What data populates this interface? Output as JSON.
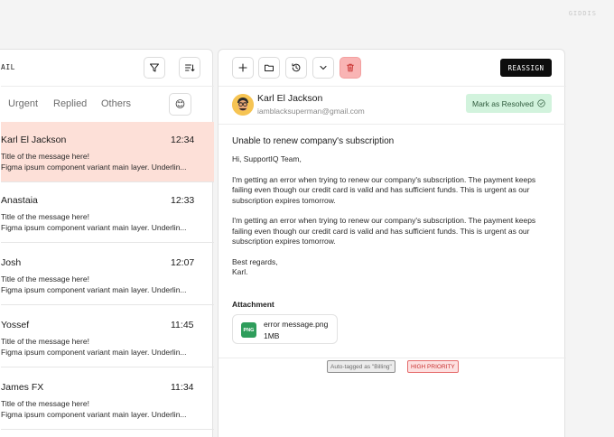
{
  "watermark": "GIDDIS",
  "inbox": {
    "title": "AIL",
    "tabs": [
      {
        "label": "Urgent"
      },
      {
        "label": "Replied"
      },
      {
        "label": "Others"
      }
    ],
    "emoji": "😊",
    "messages": [
      {
        "name": "Karl El Jackson",
        "time": "12:34",
        "subject": "Title of the message here!",
        "preview": "Figma ipsum component variant main layer. Underlin...",
        "active": true
      },
      {
        "name": "Anastaia",
        "time": "12:33",
        "subject": "Title of the message here!",
        "preview": "Figma ipsum component variant main layer. Underlin..."
      },
      {
        "name": "Josh",
        "time": "12:07",
        "subject": "Title of the message here!",
        "preview": "Figma ipsum component variant main layer. Underlin..."
      },
      {
        "name": "Yossef",
        "time": "11:45",
        "subject": "Title of the message here!",
        "preview": "Figma ipsum component variant main layer. Underlin..."
      },
      {
        "name": "James FX",
        "time": "11:34",
        "subject": "Title of the message here!",
        "preview": "Figma ipsum component variant main layer. Underlin..."
      }
    ]
  },
  "toolbar": {
    "icons": [
      "plus-icon",
      "folder-icon",
      "history-icon",
      "chevron-down-icon",
      "trash-icon"
    ],
    "reassign_label": "REASSIGN"
  },
  "email": {
    "sender_name": "Karl El Jackson",
    "sender_email": "iamblacksuperman@gmail.com",
    "resolve_label": "Mark as Resolved",
    "subject": "Unable to renew company's subscription",
    "greeting": "Hi, SupportIQ Team,",
    "paragraph1": "I'm getting an error when trying to renew our company's subscription. The payment keeps failing even though our credit card is valid and has sufficient funds. This is urgent as our subscription expires tomorrow.",
    "paragraph2": "I'm getting an error when trying to renew our company's subscription. The payment keeps failing even though our credit card is valid and has sufficient funds. This is urgent as our subscription expires tomorrow.",
    "signoff": "Best regards,",
    "signature": "Karl.",
    "attachment_title": "Attachment",
    "attachment": {
      "badge": "PNG",
      "name": "error message.png",
      "size": "1MB"
    },
    "tags": [
      {
        "label": "Auto-tagged as \"Billing\""
      },
      {
        "label": "HIGH PRIORITY"
      }
    ]
  },
  "colors": {
    "active_row": "#fde0d8",
    "resolve_bg": "#d2f3dd",
    "trash_bg": "#f9b4b4",
    "priority": "#c8302f",
    "png_badge": "#2e9d5b"
  }
}
